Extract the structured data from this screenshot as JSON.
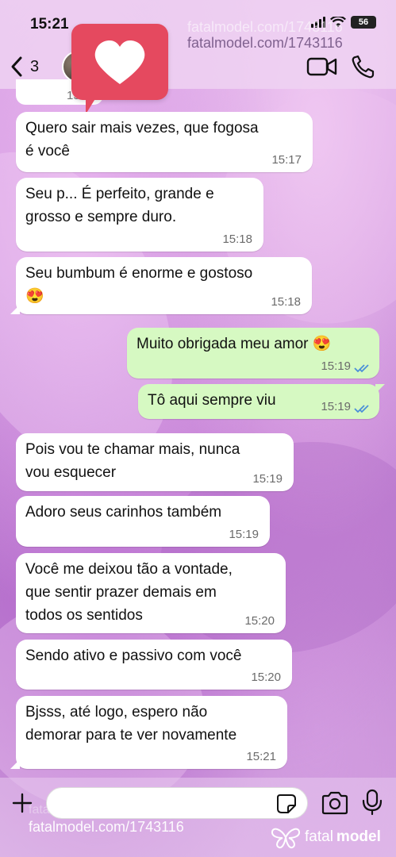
{
  "status": {
    "time": "15:21",
    "battery": "56"
  },
  "header": {
    "back_count": "3"
  },
  "watermark": {
    "url": "fatalmodel.com/1743116",
    "brand_light": "fatal",
    "brand_bold": "model"
  },
  "partial_time": "15:1",
  "messages": [
    {
      "dir": "in",
      "lines": [
        "Quero sair mais vezes, que fogosa",
        "é você"
      ],
      "time": "15:17"
    },
    {
      "dir": "in",
      "lines": [
        "Seu p... É perfeito, grande e",
        "grosso e sempre duro."
      ],
      "time": "15:18"
    },
    {
      "dir": "in",
      "lines": [
        "Seu bumbum é enorme e gostoso",
        "😍"
      ],
      "time": "15:18"
    },
    {
      "dir": "out",
      "lines": [
        "Muito obrigada meu amor 😍"
      ],
      "time": "15:19",
      "read": true
    },
    {
      "dir": "out",
      "lines": [
        "Tô aqui sempre viu"
      ],
      "time": "15:19",
      "read": true
    },
    {
      "dir": "in",
      "lines": [
        "Pois vou te chamar mais, nunca",
        "vou esquecer"
      ],
      "time": "15:19"
    },
    {
      "dir": "in",
      "lines": [
        "Adoro seus carinhos também"
      ],
      "time": "15:19"
    },
    {
      "dir": "in",
      "lines": [
        "Você me deixou tão a vontade,",
        "que sentir prazer demais em",
        "todos os sentidos"
      ],
      "time": "15:20"
    },
    {
      "dir": "in",
      "lines": [
        "Sendo ativo e passivo com você"
      ],
      "time": "15:20"
    },
    {
      "dir": "in",
      "lines": [
        "Bjsss, até logo, espero não",
        "demorar para te ver novamente"
      ],
      "time": "15:21"
    }
  ],
  "input": {
    "value": "",
    "placeholder": ""
  },
  "colors": {
    "incoming": "#ffffff",
    "outgoing": "#d6f9c2",
    "read_ticks": "#4a8fd9",
    "badge": "#e5495f"
  },
  "icons": [
    "back-chevron-icon",
    "video-call-icon",
    "phone-icon",
    "heart-icon",
    "plus-icon",
    "sticker-icon",
    "camera-icon",
    "microphone-icon",
    "double-check-icon"
  ]
}
